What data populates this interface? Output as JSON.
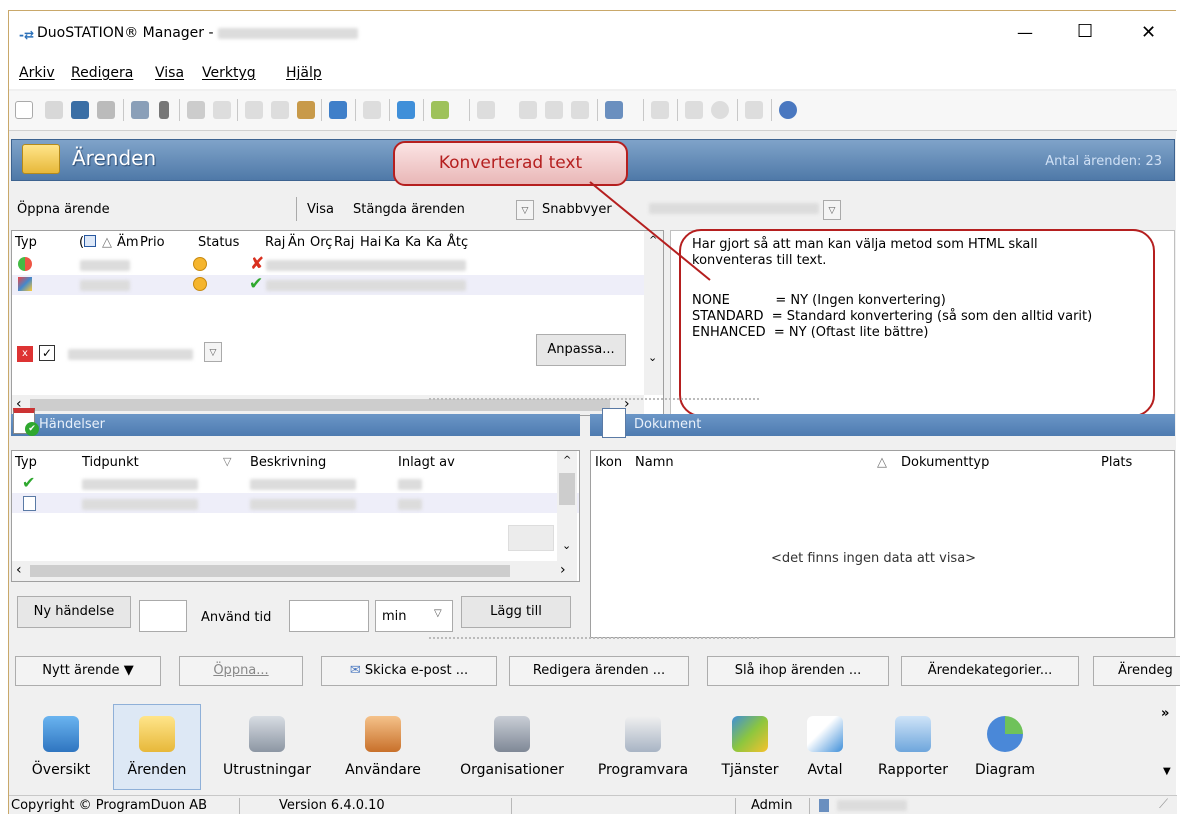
{
  "window": {
    "title": "DuoSTATION® Manager -",
    "minimize": "—",
    "maximize": "☐",
    "close": "✕"
  },
  "menu": [
    "Arkiv",
    "Redigera",
    "Visa",
    "Verktyg",
    "Hjälp"
  ],
  "header": {
    "title": "Ärenden",
    "count": "Antal ärenden:  23"
  },
  "filter": {
    "open": "Öppna ärende",
    "visa_label": "Visa",
    "visa_value": "Stängda ärenden",
    "snabbvyer": "Snabbvyer"
  },
  "cases": {
    "columns": [
      "Typ",
      "(",
      "△",
      "Äm",
      "Prio",
      "Status",
      "Raj",
      "Än",
      "Orç",
      "Raj",
      "Hai",
      "Ka",
      "Ka",
      "Ka",
      "Åtç"
    ],
    "customize": "Anpassa..."
  },
  "callout": "Konverterad text",
  "notes": {
    "lines": [
      "Har gjort så att man kan välja metod som HTML skall",
      "konventeras till text.",
      "",
      "NONE           = NY (Ingen konvertering)",
      "STANDARD  = Standard konvertering (så som den alltid varit)",
      "ENHANCED  = NY (Oftast lite bättre)"
    ]
  },
  "events": {
    "title": "Händelser",
    "columns": [
      "Typ",
      "Tidpunkt",
      "▽",
      "Beskrivning",
      "Inlagt av"
    ],
    "new_event": "Ny händelse",
    "use_time": "Använd tid",
    "unit": "min",
    "add": "Lägg till"
  },
  "docs": {
    "title": "Dokument",
    "columns": [
      "Ikon",
      "Namn",
      "△",
      "Dokumenttyp",
      "Plats"
    ],
    "empty": "<det finns ingen data att visa>"
  },
  "actions": {
    "new": "Nytt ärende",
    "open": "Öppna...",
    "email": "Skicka e-post ...",
    "edit": "Redigera ärenden ...",
    "merge": "Slå ihop ärenden ...",
    "categories": "Ärendekategorier...",
    "more": "Ärendeg"
  },
  "nav": [
    "Översikt",
    "Ärenden",
    "Utrustningar",
    "Användare",
    "Organisationer",
    "Programvara",
    "Tjänster",
    "Avtal",
    "Rapporter",
    "Diagram"
  ],
  "nav_more": "»",
  "status": {
    "copyright": "Copyright © ProgramDuon AB",
    "version": "Version 6.4.0.10",
    "user": "Admin"
  },
  "colors": {
    "header": "#5a84b4",
    "callout": "#b51f1f",
    "check": "#2fa82f",
    "cross": "#d9301f"
  }
}
